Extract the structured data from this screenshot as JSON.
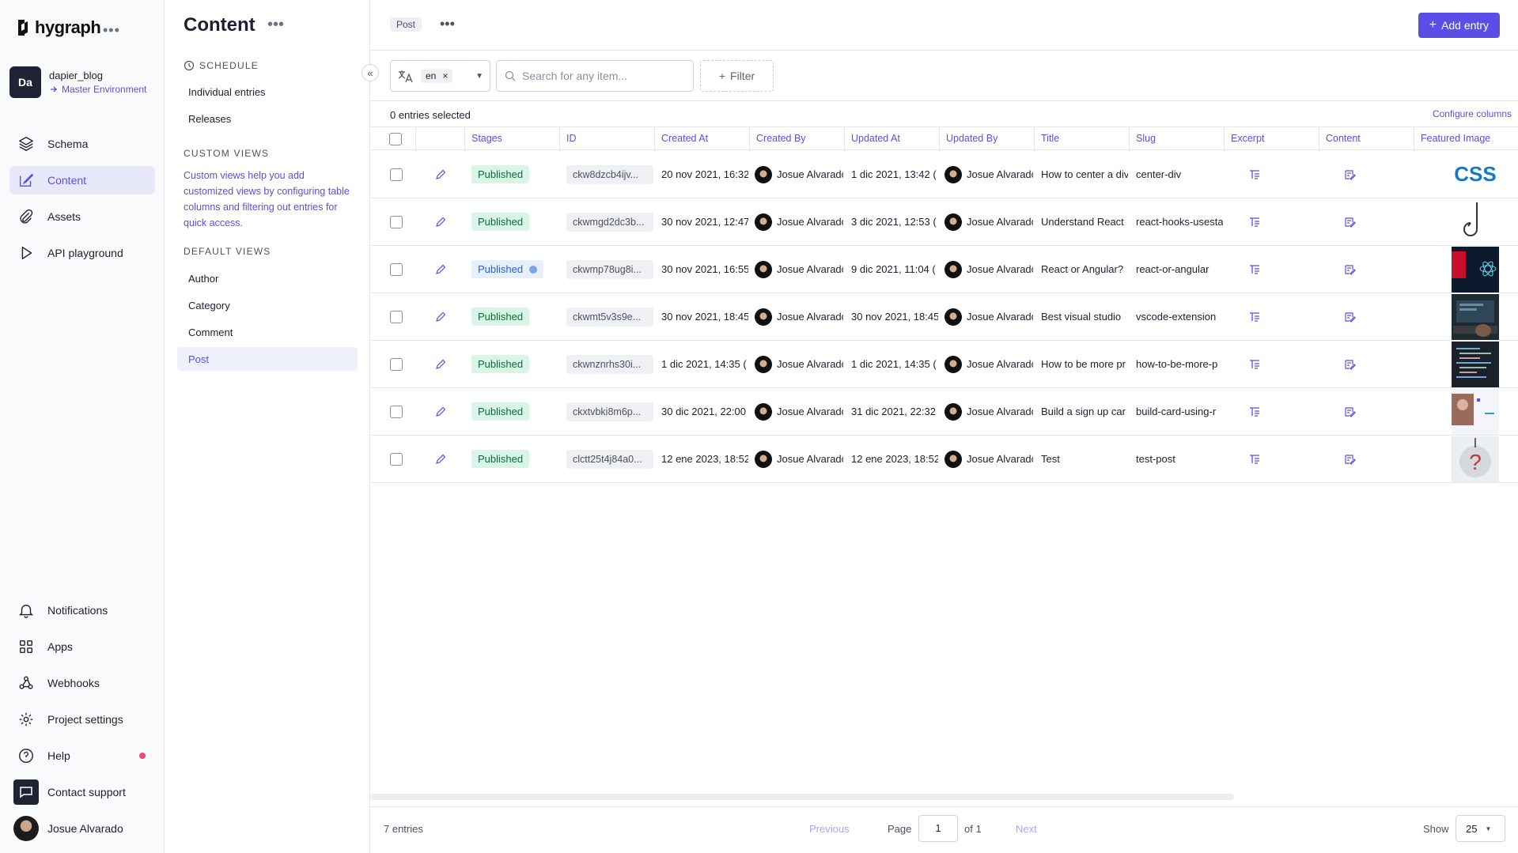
{
  "app": {
    "brand": "hygraph",
    "project_initials": "Da",
    "project_name": "dapier_blog",
    "environment": "Master Environment"
  },
  "nav": {
    "top": [
      {
        "label": "Schema",
        "icon": "layers-icon"
      },
      {
        "label": "Content",
        "icon": "edit-icon",
        "active": true
      },
      {
        "label": "Assets",
        "icon": "paperclip-icon"
      },
      {
        "label": "API playground",
        "icon": "play-icon"
      }
    ],
    "bottom": [
      {
        "label": "Notifications",
        "icon": "bell-icon"
      },
      {
        "label": "Apps",
        "icon": "apps-icon"
      },
      {
        "label": "Webhooks",
        "icon": "webhook-icon"
      },
      {
        "label": "Project settings",
        "icon": "gear-icon"
      },
      {
        "label": "Help",
        "icon": "help-icon"
      },
      {
        "label": "Contact support",
        "icon": "chat-icon"
      },
      {
        "label": "Josue Alvarado",
        "icon": "avatar"
      }
    ]
  },
  "content_sidebar": {
    "title": "Content",
    "schedule_heading": "SCHEDULE",
    "schedule_items": [
      "Individual entries",
      "Releases"
    ],
    "custom_views_heading": "CUSTOM VIEWS",
    "custom_views_desc": "Custom views help you add customized views by configuring table columns and filtering out entries for quick access.",
    "default_views_heading": "DEFAULT VIEWS",
    "default_views": [
      "Author",
      "Category",
      "Comment",
      "Post"
    ],
    "active_view": "Post"
  },
  "main": {
    "model_chip": "Post",
    "add_entry_label": "Add entry",
    "locale": "en",
    "search_placeholder": "Search for any item...",
    "filter_label": "Filter",
    "selection_text": "0 entries selected",
    "configure_columns": "Configure columns",
    "columns": [
      "Stages",
      "ID",
      "Created At",
      "Created By",
      "Updated At",
      "Updated By",
      "Title",
      "Slug",
      "Excerpt",
      "Content",
      "Featured Image"
    ],
    "rows": [
      {
        "stage": "Published",
        "modified": false,
        "id": "ckw8dzcb4ijv...",
        "created_at": "20 nov 2021, 16:32 (",
        "created_by": "Josue Alvarado",
        "updated_at": "1 dic 2021, 13:42 (",
        "updated_by": "Josue Alvarado",
        "title": "How to center a div",
        "slug": "center-div",
        "image": "css"
      },
      {
        "stage": "Published",
        "modified": false,
        "id": "ckwmgd2dc3b...",
        "created_at": "30 nov 2021, 12:47",
        "created_by": "Josue Alvarado",
        "updated_at": "3 dic 2021, 12:53 (",
        "updated_by": "Josue Alvarado",
        "title": "Understand React",
        "slug": "react-hooks-usestate",
        "image": "hook"
      },
      {
        "stage": "Published",
        "modified": true,
        "id": "ckwmp78ug8i...",
        "created_at": "30 nov 2021, 16:55",
        "created_by": "Josue Alvarado",
        "updated_at": "9 dic 2021, 11:04 (",
        "updated_by": "Josue Alvarado",
        "title": "React or Angular?",
        "slug": "react-or-angular",
        "image": "react"
      },
      {
        "stage": "Published",
        "modified": false,
        "id": "ckwmt5v3s9e...",
        "created_at": "30 nov 2021, 18:45",
        "created_by": "Josue Alvarado",
        "updated_at": "30 nov 2021, 18:45",
        "updated_by": "Josue Alvarado",
        "title": "Best visual studio",
        "slug": "vscode-extension",
        "image": "laptop"
      },
      {
        "stage": "Published",
        "modified": false,
        "id": "ckwnznrhs30i...",
        "created_at": "1 dic 2021, 14:35 (",
        "created_by": "Josue Alvarado",
        "updated_at": "1 dic 2021, 14:35 (",
        "updated_by": "Josue Alvarado",
        "title": "How to be more pr",
        "slug": "how-to-be-more-p",
        "image": "code"
      },
      {
        "stage": "Published",
        "modified": false,
        "id": "ckxtvbki8m6p...",
        "created_at": "30 dic 2021, 22:00",
        "created_by": "Josue Alvarado",
        "updated_at": "31 dic 2021, 22:32",
        "updated_by": "Josue Alvarado",
        "title": "Build a sign up car",
        "slug": "build-card-using-r",
        "image": "card"
      },
      {
        "stage": "Published",
        "modified": false,
        "id": "clctt25t4j84a0...",
        "created_at": "12 ene 2023, 18:52",
        "created_by": "Josue Alvarado",
        "updated_at": "12 ene 2023, 18:52",
        "updated_by": "Josue Alvarado",
        "title": "Test",
        "slug": "test-post",
        "image": "question"
      }
    ],
    "footer": {
      "count": "7 entries",
      "previous": "Previous",
      "page_label": "Page",
      "page_value": "1",
      "of_label": "of 1",
      "next": "Next",
      "show_label": "Show",
      "show_value": "25"
    }
  },
  "colors": {
    "accent": "#5b4ee6",
    "published_bg": "#d8f5e7",
    "published_text": "#0b6b3a"
  }
}
